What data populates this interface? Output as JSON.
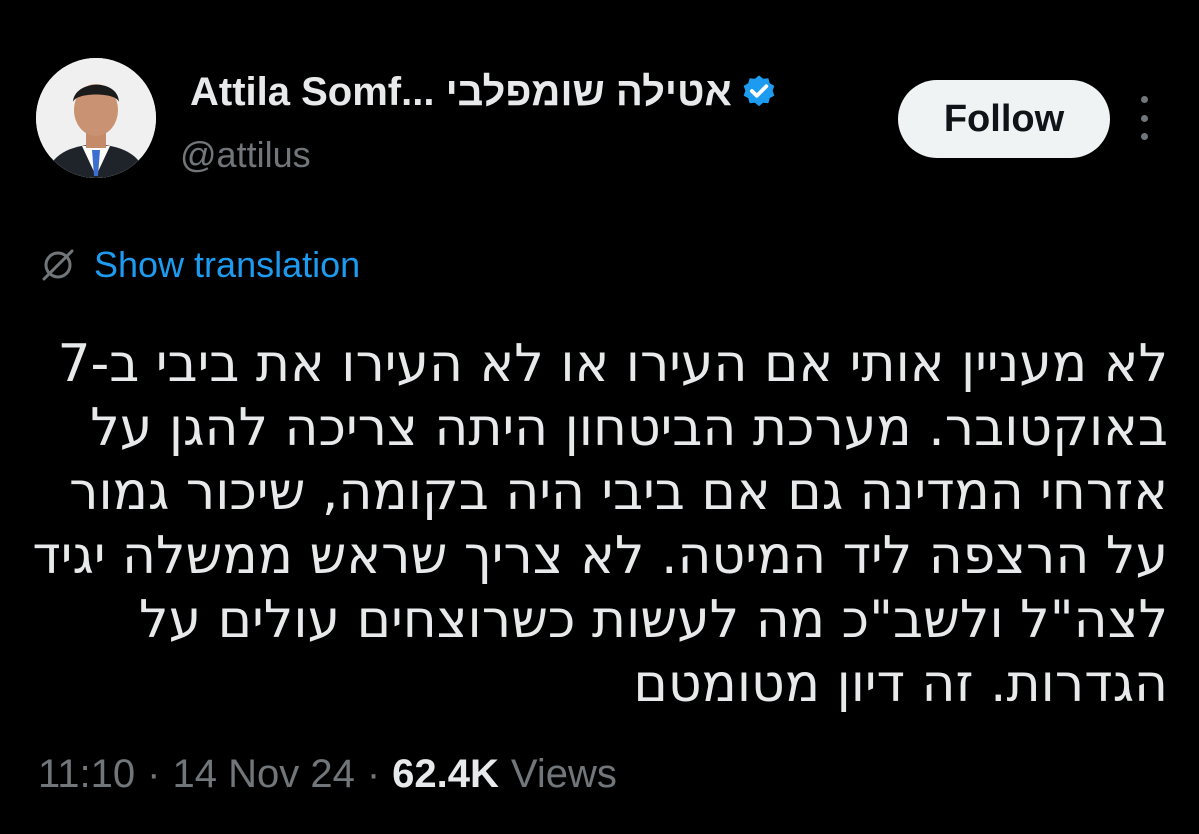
{
  "author": {
    "display_name": "Attila Somf... אטילה שומפלבי",
    "handle": "@attilus",
    "verified": true
  },
  "actions": {
    "follow_label": "Follow"
  },
  "translation": {
    "label": "Show translation"
  },
  "tweet": {
    "lines": [
      "לא מעניין אותי אם העירו או לא העירו את ביבי ב-7",
      "באוקטובר. מערכת הביטחון היתה צריכה להגן על",
      "אזרחי המדינה גם אם ביבי היה בקומה, שיכור גמור",
      "על הרצפה ליד המיטה. לא צריך שראש ממשלה יגיד",
      "לצה\"ל ולשב\"כ מה לעשות כשרוצחים עולים על",
      "הגדרות. זה דיון מטומטם"
    ]
  },
  "meta": {
    "time": "11:10",
    "date": "14 Nov 24",
    "views_count": "62.4K",
    "views_label": "Views",
    "separator": "·"
  },
  "colors": {
    "background": "#000000",
    "text": "#e7e9ea",
    "secondary": "#71767b",
    "accent": "#1d9bf0",
    "button_bg": "#eff3f4"
  },
  "icons": [
    "verified-badge-icon",
    "globe-icon",
    "more-icon"
  ]
}
